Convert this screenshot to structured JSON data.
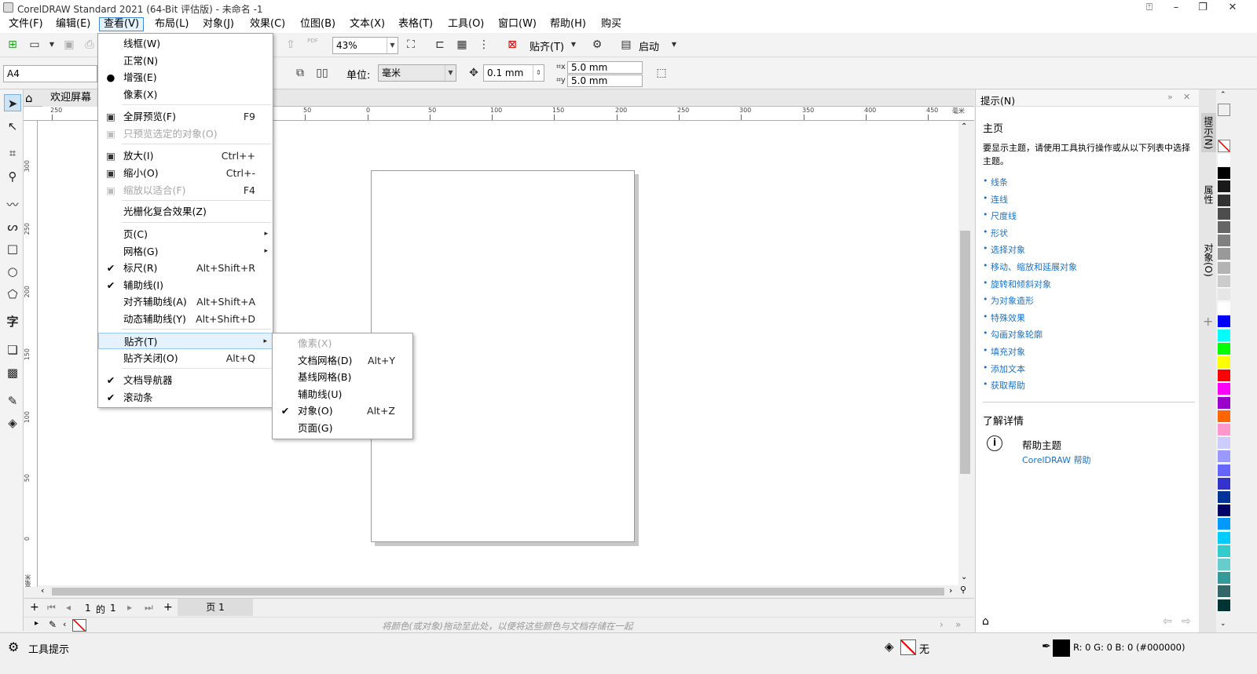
{
  "window": {
    "title": "CorelDRAW Standard 2021 (64-Bit 评估版) - 未命名 -1"
  },
  "menubar": {
    "items": [
      "文件(F)",
      "编辑(E)",
      "查看(V)",
      "布局(L)",
      "对象(J)",
      "效果(C)",
      "位图(B)",
      "文本(X)",
      "表格(T)",
      "工具(O)",
      "窗口(W)",
      "帮助(H)",
      "购买"
    ],
    "active": "查看(V)"
  },
  "toolbar": {
    "zoom": "43%",
    "snap_label": "贴齐(T)",
    "launch_label": "启动",
    "pdf": "PDF"
  },
  "propertybar": {
    "page_size": "A4",
    "units_label": "单位:",
    "units_value": "毫米",
    "nudge": "0.1 mm",
    "dup_x": "5.0 mm",
    "dup_y": "5.0 mm"
  },
  "tabs": {
    "welcome": "欢迎屏幕"
  },
  "rulers": {
    "h_ticks": [
      "250",
      "50",
      "0",
      "50",
      "100",
      "150",
      "200",
      "250",
      "300",
      "350",
      "400",
      "450"
    ],
    "h_unit": "毫米",
    "v_ticks": [
      "300",
      "250",
      "200",
      "150",
      "100",
      "50",
      "0"
    ],
    "v_unit": "毫米"
  },
  "view_menu": {
    "items": [
      {
        "label": "线框(W)",
        "shortcut": "",
        "mark": "",
        "disabled": false
      },
      {
        "label": "正常(N)",
        "shortcut": "",
        "mark": "",
        "disabled": false
      },
      {
        "label": "增强(E)",
        "shortcut": "",
        "mark": "●",
        "disabled": false
      },
      {
        "label": "像素(X)",
        "shortcut": "",
        "mark": "",
        "disabled": false
      },
      {
        "label": "全屏预览(F)",
        "shortcut": "F9",
        "mark": "",
        "disabled": false
      },
      {
        "label": "只预览选定的对象(O)",
        "shortcut": "",
        "mark": "",
        "disabled": true
      },
      {
        "label": "放大(I)",
        "shortcut": "Ctrl++",
        "mark": "",
        "disabled": false
      },
      {
        "label": "缩小(O)",
        "shortcut": "Ctrl+-",
        "mark": "",
        "disabled": false
      },
      {
        "label": "缩放以适合(F)",
        "shortcut": "F4",
        "mark": "",
        "disabled": true
      },
      {
        "label": "光栅化复合效果(Z)",
        "shortcut": "",
        "mark": "",
        "disabled": false
      },
      {
        "label": "页(C)",
        "shortcut": "▸",
        "mark": "",
        "disabled": false
      },
      {
        "label": "网格(G)",
        "shortcut": "▸",
        "mark": "",
        "disabled": false
      },
      {
        "label": "标尺(R)",
        "shortcut": "Alt+Shift+R",
        "mark": "✔",
        "disabled": false
      },
      {
        "label": "辅助线(I)",
        "shortcut": "",
        "mark": "✔",
        "disabled": false
      },
      {
        "label": "对齐辅助线(A)",
        "shortcut": "Alt+Shift+A",
        "mark": "",
        "disabled": false
      },
      {
        "label": "动态辅助线(Y)",
        "shortcut": "Alt+Shift+D",
        "mark": "",
        "disabled": false
      },
      {
        "label": "贴齐(T)",
        "shortcut": "▸",
        "mark": "",
        "disabled": false
      },
      {
        "label": "贴齐关闭(O)",
        "shortcut": "Alt+Q",
        "mark": "",
        "disabled": false
      },
      {
        "label": "文档导航器",
        "shortcut": "",
        "mark": "✔",
        "disabled": false
      },
      {
        "label": "滚动条",
        "shortcut": "",
        "mark": "✔",
        "disabled": false
      }
    ]
  },
  "snap_submenu": {
    "items": [
      {
        "label": "像素(X)",
        "shortcut": "",
        "mark": "",
        "disabled": true
      },
      {
        "label": "文档网格(D)",
        "shortcut": "Alt+Y",
        "mark": "",
        "disabled": false
      },
      {
        "label": "基线网格(B)",
        "shortcut": "",
        "mark": "",
        "disabled": false
      },
      {
        "label": "辅助线(U)",
        "shortcut": "",
        "mark": "",
        "disabled": false
      },
      {
        "label": "对象(O)",
        "shortcut": "Alt+Z",
        "mark": "✔",
        "disabled": false
      },
      {
        "label": "页面(G)",
        "shortcut": "",
        "mark": "",
        "disabled": false
      }
    ]
  },
  "pagebar": {
    "page_current": "1",
    "of_label": "的",
    "page_total": "1",
    "page_tab": "页 1"
  },
  "palettebar": {
    "hint": "将颜色(或对象)拖动至此处，以便将这些颜色与文档存储在一起"
  },
  "statusbar": {
    "tool_hint": "工具提示",
    "fill_none": "无",
    "color_readout": "R: 0 G: 0 B: 0 (#000000)"
  },
  "hints_panel": {
    "title": "提示(N)",
    "heading": "主页",
    "intro": "要显示主题，请使用工具执行操作或从以下列表中选择主题。",
    "links": [
      "线条",
      "连线",
      "尺度线",
      "形状",
      "选择对象",
      "移动、缩放和延展对象",
      "旋转和倾斜对象",
      "为对象造形",
      "特殊效果",
      "勾画对象轮廓",
      "填充对象",
      "添加文本",
      "获取帮助"
    ],
    "learn_more": "了解详情",
    "help_topic": "帮助主题",
    "help_link": "CorelDRAW 帮助"
  },
  "side_tabs": [
    "提示(N)",
    "属性",
    "对象(O)"
  ],
  "palette_colors": [
    "#ffffff",
    "#000000",
    "#1a1a1a",
    "#333333",
    "#4d4d4d",
    "#666666",
    "#808080",
    "#999999",
    "#b3b3b3",
    "#cccccc",
    "#e6e6e6",
    "#ffffff",
    "#0000ff",
    "#00ffff",
    "#00ff00",
    "#ffff00",
    "#ff0000",
    "#ff00ff",
    "#9900cc",
    "#ff6600",
    "#ff99cc",
    "#ccccff",
    "#9999ff",
    "#6666ff",
    "#3333cc",
    "#003399",
    "#000066",
    "#0099ff",
    "#00ccff",
    "#33cccc",
    "#66cccc",
    "#339999",
    "#336666",
    "#003333"
  ]
}
